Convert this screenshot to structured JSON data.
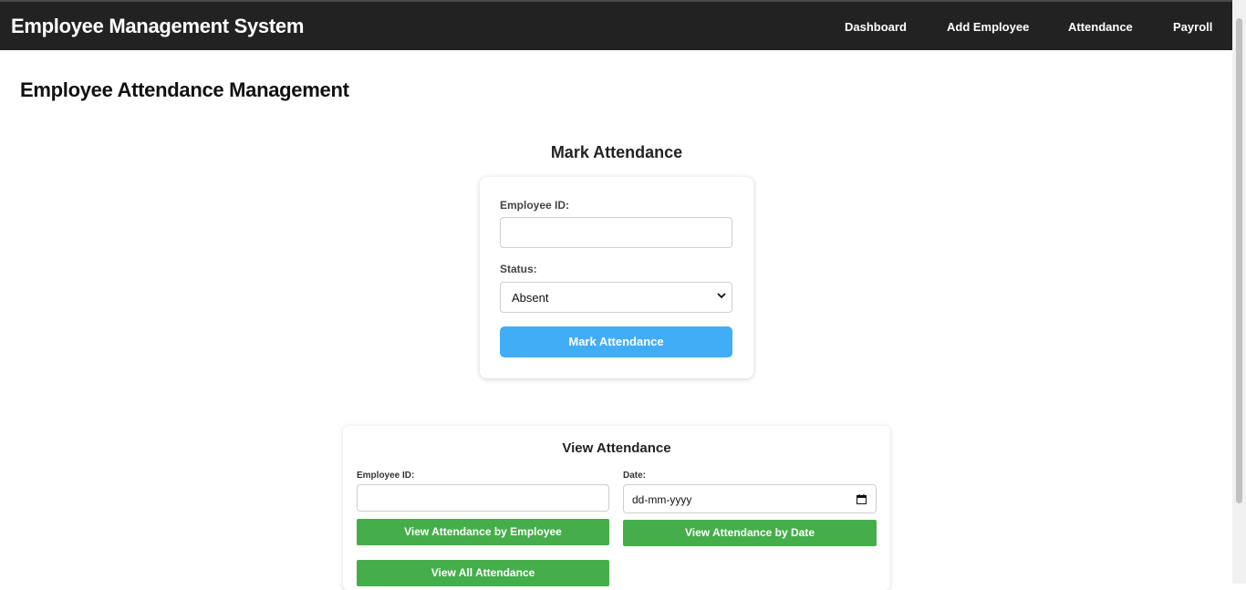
{
  "navbar": {
    "brand": "Employee Management System",
    "links": [
      "Dashboard",
      "Add Employee",
      "Attendance",
      "Payroll"
    ]
  },
  "page": {
    "title": "Employee Attendance Management"
  },
  "mark_attendance": {
    "title": "Mark Attendance",
    "employee_id_label": "Employee ID:",
    "employee_id_value": "",
    "status_label": "Status:",
    "status_selected": "Absent",
    "submit_label": "Mark Attendance",
    "button_color": "#42adf7"
  },
  "view_attendance": {
    "title": "View Attendance",
    "employee_id_label": "Employee ID:",
    "employee_id_value": "",
    "date_label": "Date:",
    "date_placeholder": "dd-mm-yyyy",
    "by_employee_label": "View Attendance by Employee",
    "by_date_label": "View Attendance by Date",
    "view_all_label": "View All Attendance",
    "button_color": "#45ae4a"
  }
}
